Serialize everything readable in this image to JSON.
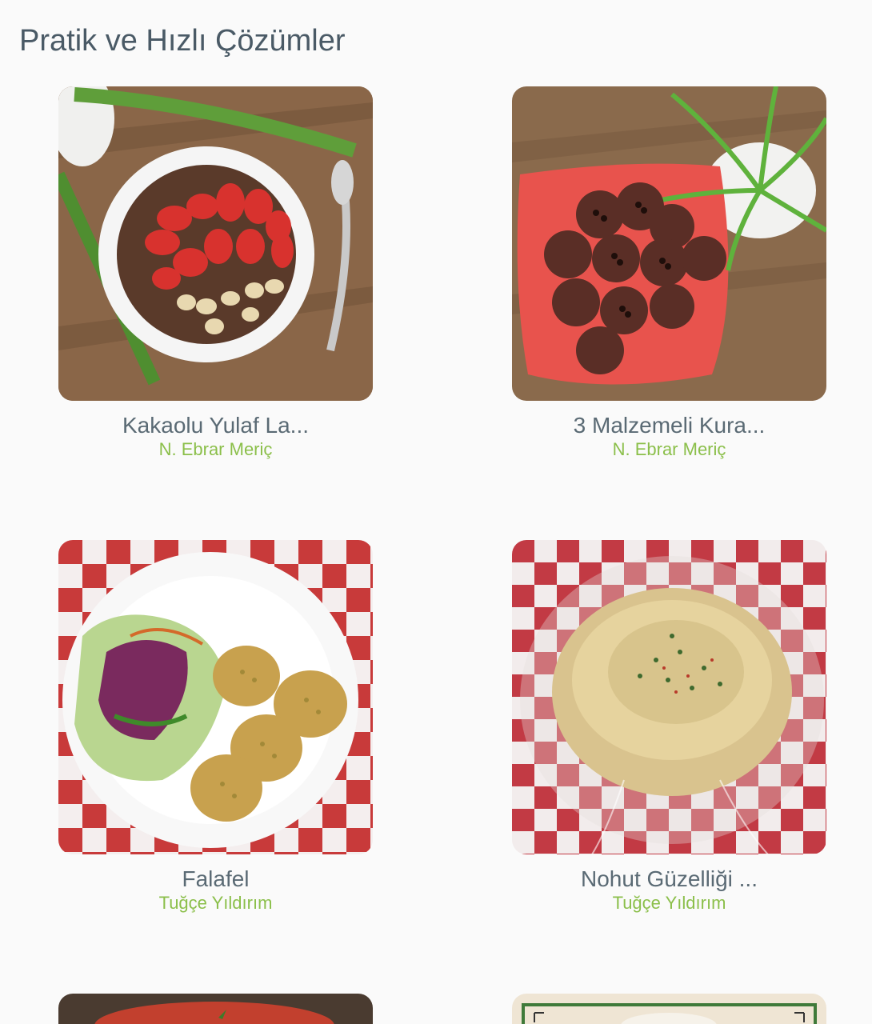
{
  "section": {
    "title": "Pratik ve Hızlı Çözümler"
  },
  "recipes": [
    {
      "title": "Kakaolu Yulaf La...",
      "author": "N. Ebrar Meriç",
      "image": "chocolate-oatmeal-strawberries-photo"
    },
    {
      "title": "3 Malzemeli Kura...",
      "author": "N. Ebrar Meriç",
      "image": "chocolate-cookies-red-plate-photo"
    },
    {
      "title": "Falafel",
      "author": "Tuğçe Yıldırım",
      "image": "falafel-salad-plate-photo"
    },
    {
      "title": "Nohut Güzelliği ...",
      "author": "Tuğçe Yıldırım",
      "image": "hummus-checkered-cloth-photo"
    }
  ],
  "partial_recipes": [
    {
      "image": "red-dish-photo"
    },
    {
      "image": "framed-dish-photo"
    }
  ],
  "colors": {
    "title": "#4a5a66",
    "recipe_title": "#5a6a74",
    "author": "#8bbf4a",
    "background": "#fafafa"
  }
}
